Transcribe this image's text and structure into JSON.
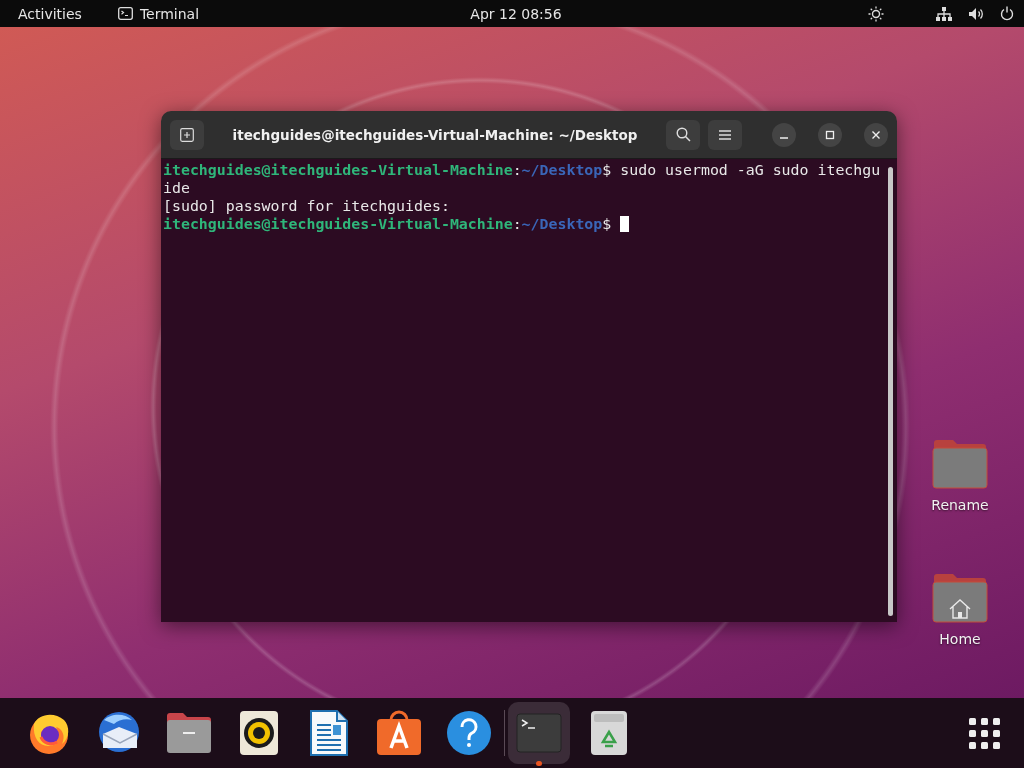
{
  "top_bar": {
    "activities": "Activities",
    "app_menu": "Terminal",
    "clock": "Apr 12  08:56"
  },
  "terminal": {
    "title": "itechguides@itechguides-Virtual-Machine: ~/Desktop",
    "lines": [
      {
        "kind": "prompt",
        "user": "itechguides@itechguides-Virtual-Machine",
        "sep": ":",
        "path": "~/Desktop",
        "symbol": "$",
        "command": " sudo usermod -aG sudo itechgu",
        "cursor": false
      },
      {
        "kind": "output",
        "text": "ide"
      },
      {
        "kind": "output",
        "text": "[sudo] password for itechguides:"
      },
      {
        "kind": "prompt",
        "user": "itechguides@itechguides-Virtual-Machine",
        "sep": ":",
        "path": "~/Desktop",
        "symbol": "$",
        "cursor": true
      }
    ]
  },
  "desktop_icons": [
    {
      "kind": "folder",
      "label": "Rename"
    },
    {
      "kind": "home",
      "label": "Home"
    }
  ],
  "dock": {
    "apps": [
      {
        "kind": "firefox",
        "running": false
      },
      {
        "kind": "mail",
        "running": false
      },
      {
        "kind": "files",
        "running": false
      },
      {
        "kind": "music",
        "running": false
      },
      {
        "kind": "writer",
        "running": false
      },
      {
        "kind": "software",
        "running": false
      },
      {
        "kind": "help",
        "running": false
      },
      {
        "kind": "terminal",
        "running": true
      },
      {
        "kind": "trash",
        "running": false
      }
    ]
  }
}
